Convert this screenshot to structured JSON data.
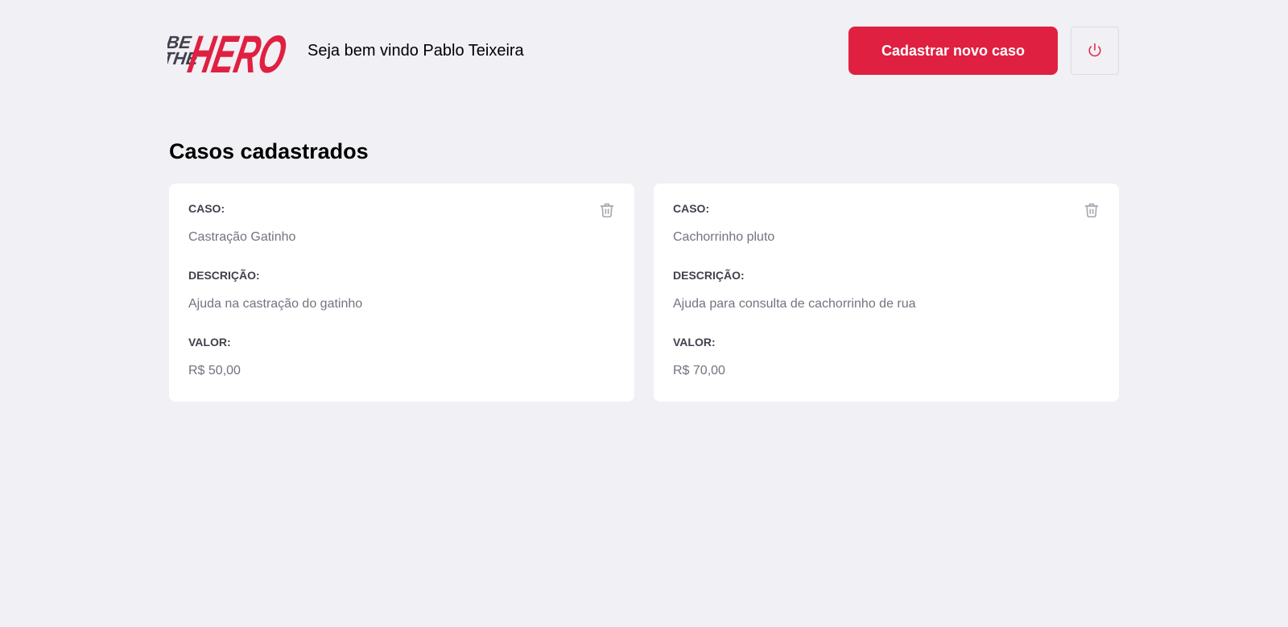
{
  "header": {
    "logo_alt": "BE THE HERO",
    "logo_text": {
      "be": "BE",
      "the": "THE",
      "hero": "HERO"
    },
    "welcome_text": "Seja bem vindo Pablo Teixeira",
    "new_case_label": "Cadastrar novo caso",
    "logout_icon": "power-icon"
  },
  "page_title": "Casos cadastrados",
  "colors": {
    "brand": "#e02041",
    "background": "#f0f0f5",
    "label": "#41414d",
    "muted": "#737380"
  },
  "cases": [
    {
      "case_label": "CASO:",
      "case_value": "Castração Gatinho",
      "description_label": "DESCRIÇÃO:",
      "description_value": "Ajuda na castração do gatinho",
      "value_label": "VALOR:",
      "value_value": "R$ 50,00",
      "delete_icon": "trash-icon"
    },
    {
      "case_label": "CASO:",
      "case_value": "Cachorrinho pluto",
      "description_label": "DESCRIÇÃO:",
      "description_value": "Ajuda para consulta de cachorrinho de rua",
      "value_label": "VALOR:",
      "value_value": "R$ 70,00",
      "delete_icon": "trash-icon"
    }
  ]
}
